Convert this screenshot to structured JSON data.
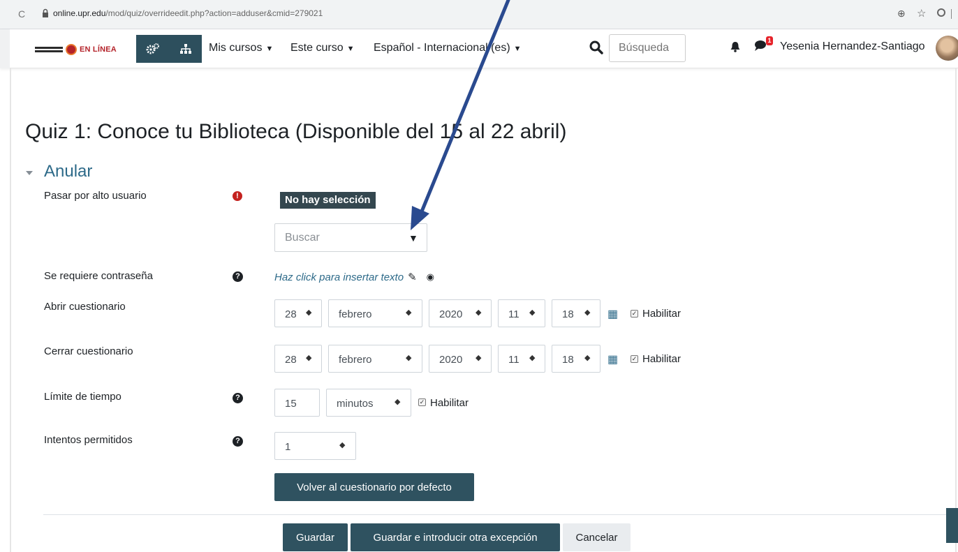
{
  "browser": {
    "url_domain": "online.upr.edu",
    "url_path": "/mod/quiz/overrideedit.php?action=adduser&cmid=279021"
  },
  "navbar": {
    "logo_text": "EN LÍNEA",
    "menus": [
      "Mis cursos",
      "Este curso",
      "Español - Internacional (es)"
    ],
    "search_placeholder": "Búsqueda",
    "notification_count": "1",
    "user_name": "Yesenia Hernandez-Santiago"
  },
  "page": {
    "title": "Quiz 1: Conoce tu Biblioteca (Disponible del 15 al 22 abril)",
    "section": "Anular"
  },
  "form": {
    "user_label": "Pasar por alto usuario",
    "no_selection": "No hay selección",
    "search_placeholder": "Buscar",
    "password_label": "Se requiere contraseña",
    "password_link": "Haz click para insertar texto",
    "open_label": "Abrir cuestionario",
    "open": {
      "day": "28",
      "month": "febrero",
      "year": "2020",
      "hour": "11",
      "minute": "18",
      "enable": "Habilitar"
    },
    "close_label": "Cerrar cuestionario",
    "close": {
      "day": "28",
      "month": "febrero",
      "year": "2020",
      "hour": "11",
      "minute": "18",
      "enable": "Habilitar"
    },
    "timelimit_label": "Límite de tiempo",
    "timelimit": {
      "value": "15",
      "unit": "minutos",
      "enable": "Habilitar"
    },
    "attempts_label": "Intentos permitidos",
    "attempts_value": "1",
    "revert_button": "Volver al cuestionario por defecto",
    "save_button": "Guardar",
    "save_another_button": "Guardar e introducir otra excepción",
    "cancel_button": "Cancelar"
  },
  "icons": {
    "required": "exclamation-circle-icon",
    "help": "question-circle-icon",
    "calendar": "calendar-icon",
    "annotation": "arrow-annotation"
  },
  "colors": {
    "primary": "#2f5260",
    "link": "#2d6a89",
    "annotation_arrow": "#2a4a8f"
  }
}
